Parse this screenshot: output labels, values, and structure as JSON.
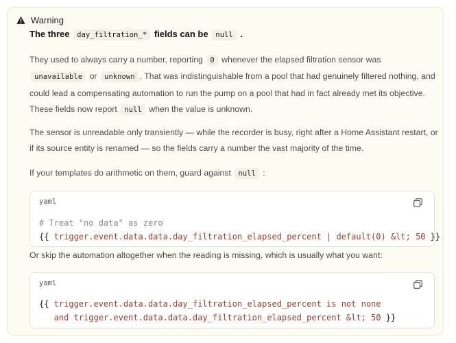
{
  "callout": {
    "icon": "warning-triangle-icon",
    "label": "Warning",
    "title": {
      "pre": "The three",
      "code": "day_filtration_*",
      "post": "fields can be",
      "code2": "null",
      "end": "."
    },
    "p1": {
      "t1": "They used to always carry a number, reporting",
      "c1": "0",
      "t2": "whenever the elapsed filtration sensor was",
      "c2": "unavailable",
      "t3": "or",
      "c3": "unknown",
      "t4": ". That was indistinguishable from a pool that had genuinely filtered nothing, and could lead a compensating automation to run the pump on a pool that had in fact already met its objective. These fields now report",
      "c4": "null",
      "t5": "when the value is unknown."
    },
    "p2": "The sensor is unreadable only transiently — while the recorder is busy, right after a Home Assistant restart, or if its source entity is renamed — so the fields carry a number the vast majority of the time.",
    "p3": {
      "t1": "If your templates do arithmetic on them, guard against",
      "c1": "null",
      "t2": ":"
    },
    "code1": {
      "lang": "yaml",
      "comment": "# Treat \"no data\" as zero",
      "open": "{{",
      "expr": " trigger.event.data.data.day_filtration_elapsed_percent | default(0) &lt; 50 ",
      "close": "}}"
    },
    "p4": "Or skip the automation altogether when the reading is missing, which is usually what you want:",
    "code2": {
      "lang": "yaml",
      "l1_open": "{{",
      "l1_expr": " trigger.event.data.data.day_filtration_elapsed_percent is not none",
      "l2_expr": "   and trigger.event.data.data.day_filtration_elapsed_percent &lt; 50 ",
      "l2_close": "}}"
    },
    "copy_icon": "copy-icon"
  }
}
